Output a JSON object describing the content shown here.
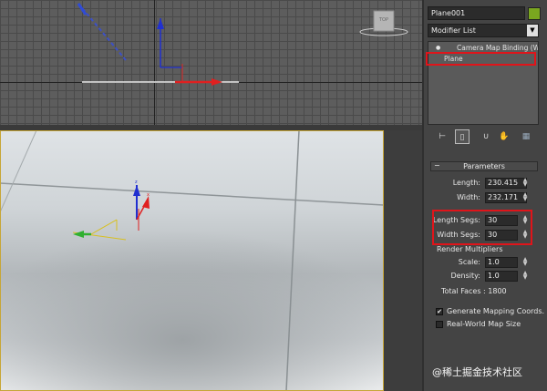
{
  "panel": {
    "object_name": "Plane001",
    "object_color": "#7aa61f",
    "modifier_list": "Modifier List",
    "stack": [
      {
        "label": "Camera Map Binding (WS",
        "has_eye_icon": true
      },
      {
        "label": "Plane"
      }
    ],
    "toolbar_icons": [
      "pin-stack-icon",
      "show-end-result-icon",
      "make-unique-icon",
      "remove-modifier-icon",
      "configure-modifier-sets-icon"
    ]
  },
  "parameters": {
    "title": "Parameters",
    "collapse_glyph": "−",
    "length_label": "Length:",
    "length_value": "230.415",
    "width_label": "Width:",
    "width_value": "232.171",
    "length_segs_label": "Length Segs:",
    "length_segs_value": "30",
    "width_segs_label": "Width Segs:",
    "width_segs_value": "30",
    "render_multipliers_label": "Render Multipliers",
    "scale_label": "Scale:",
    "scale_value": "1.0",
    "density_label": "Density:",
    "density_value": "1.0",
    "total_faces_label": "Total Faces : 1800",
    "generate_mapping_label": "Generate Mapping Coords.",
    "generate_mapping_checked": true,
    "real_world_label": "Real-World Map Size",
    "real_world_checked": false
  },
  "viewcube_label": "TOP",
  "watermark": "@稀土掘金技术社区",
  "colors": {
    "highlight_red": "#e0141a",
    "active_viewport_border": "#c7a637",
    "axis_x": "#e02020",
    "axis_y": "#30b030",
    "axis_z": "#2030d0"
  }
}
